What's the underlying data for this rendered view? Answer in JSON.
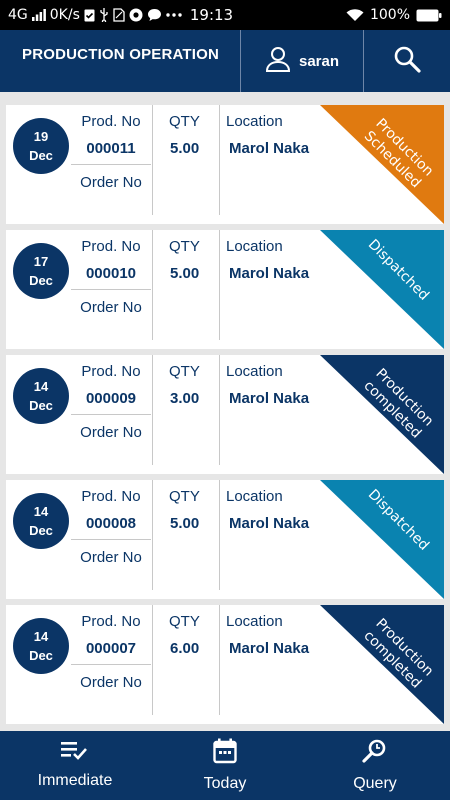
{
  "status_bar": {
    "network": "4G",
    "speed": "0K/s",
    "time": "19:13",
    "battery": "100%"
  },
  "header": {
    "title": "PRODUCTION OPERATION",
    "username": "saran"
  },
  "labels": {
    "prod_no": "Prod. No",
    "qty": "QTY",
    "location": "Location",
    "order_no": "Order No"
  },
  "colors": {
    "primary": "#0b3566",
    "scheduled": "#e07a10",
    "dispatched": "#0a83b0",
    "completed": "#0b3566"
  },
  "items": [
    {
      "day": "19",
      "month": "Dec",
      "prod_no": "000011",
      "qty": "5.00",
      "location": "Marol Naka",
      "status_line1": "Production",
      "status_line2": "Scheduled",
      "status_color": "#e07a10"
    },
    {
      "day": "17",
      "month": "Dec",
      "prod_no": "000010",
      "qty": "5.00",
      "location": "Marol Naka",
      "status_line1": "Dispatched",
      "status_line2": "",
      "status_color": "#0a83b0"
    },
    {
      "day": "14",
      "month": "Dec",
      "prod_no": "000009",
      "qty": "3.00",
      "location": "Marol Naka",
      "status_line1": "Production",
      "status_line2": "completed",
      "status_color": "#0b3566"
    },
    {
      "day": "14",
      "month": "Dec",
      "prod_no": "000008",
      "qty": "5.00",
      "location": "Marol Naka",
      "status_line1": "Dispatched",
      "status_line2": "",
      "status_color": "#0a83b0"
    },
    {
      "day": "14",
      "month": "Dec",
      "prod_no": "000007",
      "qty": "6.00",
      "location": "Marol Naka",
      "status_line1": "Production",
      "status_line2": "completed",
      "status_color": "#0b3566"
    }
  ],
  "bottom_nav": {
    "immediate": "Immediate",
    "today": "Today",
    "query": "Query"
  }
}
